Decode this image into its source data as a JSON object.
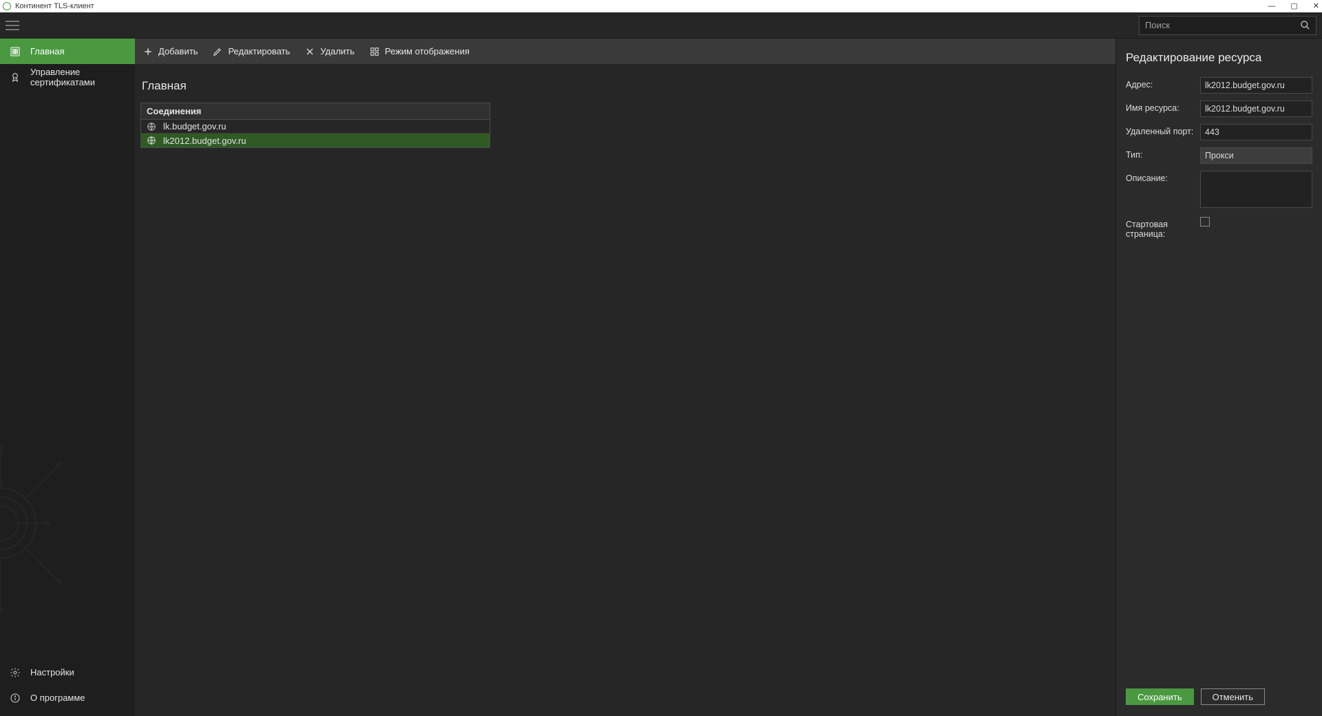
{
  "app": {
    "title": "Континент TLS-клиент"
  },
  "search": {
    "placeholder": "Поиск"
  },
  "sidebar": {
    "items": [
      {
        "label": "Главная",
        "active": true
      },
      {
        "label": "Управление сертификатами",
        "active": false
      }
    ],
    "bottom": [
      {
        "label": "Настройки"
      },
      {
        "label": "О программе"
      }
    ]
  },
  "toolbar": {
    "add": "Добавить",
    "edit": "Редактировать",
    "delete": "Удалить",
    "display_mode": "Режим отображения"
  },
  "page": {
    "title": "Главная"
  },
  "connections": {
    "header": "Соединения",
    "rows": [
      {
        "label": "lk.budget.gov.ru",
        "selected": false
      },
      {
        "label": "lk2012.budget.gov.ru",
        "selected": true
      }
    ]
  },
  "panel": {
    "title": "Редактирование ресурса",
    "labels": {
      "address": "Адрес:",
      "name": "Имя ресурса:",
      "port": "Удаленный порт:",
      "type": "Тип:",
      "description": "Описание:",
      "startpage": "Стартовая страница:"
    },
    "values": {
      "address": "lk2012.budget.gov.ru",
      "name": "lk2012.budget.gov.ru",
      "port": "443",
      "type": "Прокси",
      "description": "",
      "startpage_checked": false
    },
    "buttons": {
      "save": "Сохранить",
      "cancel": "Отменить"
    }
  },
  "colors": {
    "accent": "#4a9941",
    "panel_bg": "#2b2b2b"
  }
}
